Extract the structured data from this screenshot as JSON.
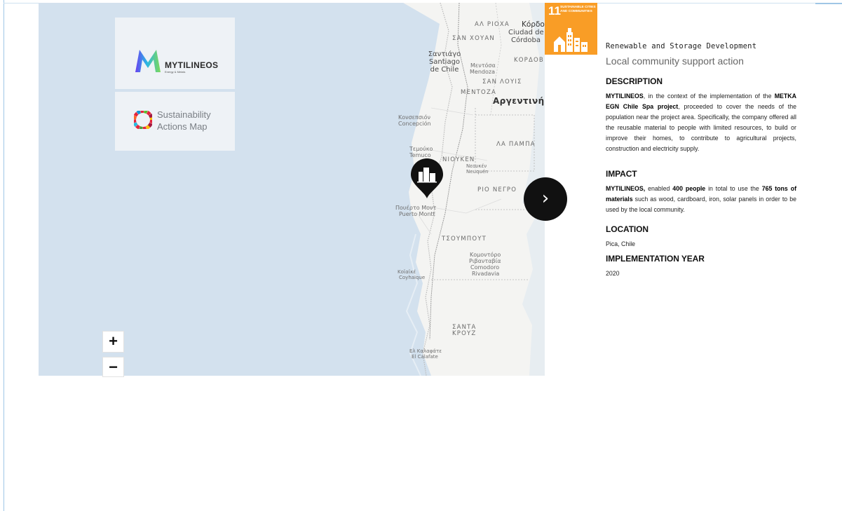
{
  "brand": {
    "company": "MYTILINEOS",
    "tagline": "Energy & Metals",
    "map_title": "Sustainability Actions Map"
  },
  "map": {
    "labels": [
      {
        "text": "ΑΛ ΡΙΟΧΑ",
        "kind": "region"
      },
      {
        "text": "Κόρδοβα",
        "kind": "city"
      },
      {
        "text": "Ciudad de",
        "kind": "city"
      },
      {
        "text": "Córdoba",
        "kind": "city"
      },
      {
        "text": "ΣΑΝ ΧΟΥΑΝ",
        "kind": "region"
      },
      {
        "text": "Σαντιάγο",
        "kind": "city"
      },
      {
        "text": "Santiago",
        "kind": "city"
      },
      {
        "text": "de Chile",
        "kind": "city"
      },
      {
        "text": "ΚΟΡΔΟΒ",
        "kind": "region"
      },
      {
        "text": "Μεντόσα",
        "kind": "small"
      },
      {
        "text": "Mendoza",
        "kind": "small"
      },
      {
        "text": "ΣΑΝ ΛΟΥΙΣ",
        "kind": "region"
      },
      {
        "text": "ΜΕΝΤΟΖΑ",
        "kind": "region"
      },
      {
        "text": "Αργεντινή",
        "kind": "country"
      },
      {
        "text": "Κονσεπσιόν",
        "kind": "small"
      },
      {
        "text": "Concepción",
        "kind": "small"
      },
      {
        "text": "ΛΑ ΠΑΜΠΑ",
        "kind": "region"
      },
      {
        "text": "Τεμούκο",
        "kind": "small"
      },
      {
        "text": "Temuco",
        "kind": "small"
      },
      {
        "text": "ΝΙΟΥΚΕΝ",
        "kind": "region"
      },
      {
        "text": "Νεουκέν",
        "kind": "small"
      },
      {
        "text": "Neuquén",
        "kind": "small"
      },
      {
        "text": "ΡΙΟ ΝΕΓΡΟ",
        "kind": "region"
      },
      {
        "text": "Πουέρτο Μοντ",
        "kind": "small"
      },
      {
        "text": "Puerto Montt",
        "kind": "small"
      },
      {
        "text": "ΤΣΟΥΜΠΟΥΤ",
        "kind": "region"
      },
      {
        "text": "Κομοντόρο",
        "kind": "small"
      },
      {
        "text": "Ριβανταβία",
        "kind": "small"
      },
      {
        "text": "Comodoro",
        "kind": "small"
      },
      {
        "text": "Rivadavia",
        "kind": "small"
      },
      {
        "text": "Κοϊαϊκέ",
        "kind": "small"
      },
      {
        "text": "Coyhaique",
        "kind": "small"
      },
      {
        "text": "ΣΑΝΤΑ",
        "kind": "region"
      },
      {
        "text": "ΚΡΟΥΖ",
        "kind": "region"
      },
      {
        "text": "Ελ Καλαφάτε",
        "kind": "small"
      },
      {
        "text": "El Calafate",
        "kind": "small"
      }
    ],
    "zoom_in": "+",
    "zoom_out": "−",
    "next_icon": "chevron-right-icon",
    "marker_icon": "city-buildings-icon",
    "next_glyph": "›"
  },
  "sdg": {
    "number": "11",
    "title": "Sustainable Cities and Communities",
    "color": "#f99d26"
  },
  "detail": {
    "sector": "Renewable and Storage Development",
    "action": "Local community support action",
    "description_heading": "DESCRIPTION",
    "description": {
      "company": "MYTILINEOS",
      "t1": ", in the context of the implementation of the ",
      "project": "METKA EGN Chile Spa project",
      "t2": ", proceeded to cover the needs of the population near the project area. Specifically, the company offered all the reusable material to people with limited resources, to build or improve their homes, to contribute to agricultural projects, construction and electricity supply."
    },
    "impact_heading": "IMPACT",
    "impact": {
      "company": "MYTILINEOS,",
      "t1": " enabled ",
      "people": "400 people",
      "t2": " in total to use the ",
      "materials": "765 tons of materials",
      "t3": " such as wood, cardboard, iron, solar panels in order to be used by the local community."
    },
    "location_heading": "LOCATION",
    "location": "Pica, Chile",
    "year_heading": "IMPLEMENTATION YEAR",
    "year": "2020"
  }
}
